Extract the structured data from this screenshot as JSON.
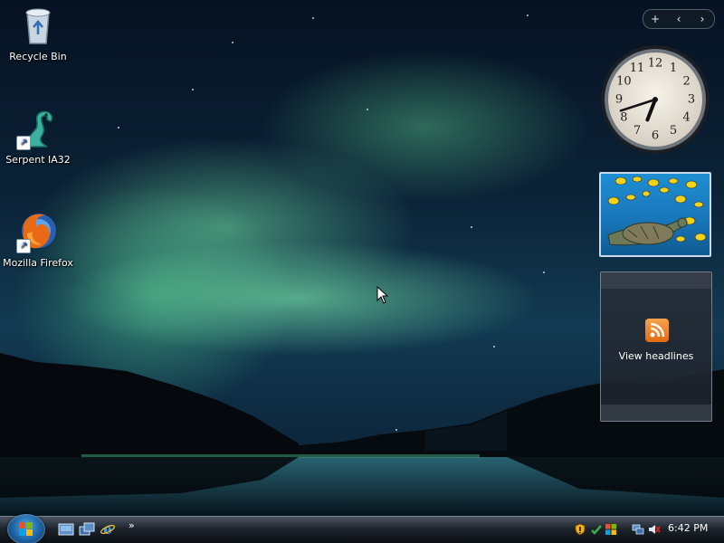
{
  "desktop": {
    "icons": [
      {
        "label": "Recycle Bin",
        "icon": "recycle-bin-icon"
      },
      {
        "label": "Serpent IA32",
        "icon": "serpent-icon"
      },
      {
        "label": "Mozilla Firefox",
        "icon": "firefox-icon"
      }
    ]
  },
  "sidebar": {
    "controls": {
      "add": "+",
      "prev": "‹",
      "next": "›"
    },
    "clock": {
      "hour": 6,
      "minute": 42,
      "numerals": [
        "12",
        "1",
        "2",
        "3",
        "4",
        "5",
        "6",
        "7",
        "8",
        "9",
        "10",
        "11"
      ]
    },
    "feed": {
      "label": "View headlines"
    }
  },
  "taskbar": {
    "time": "6:42 PM",
    "quick_launch_more": "»"
  }
}
